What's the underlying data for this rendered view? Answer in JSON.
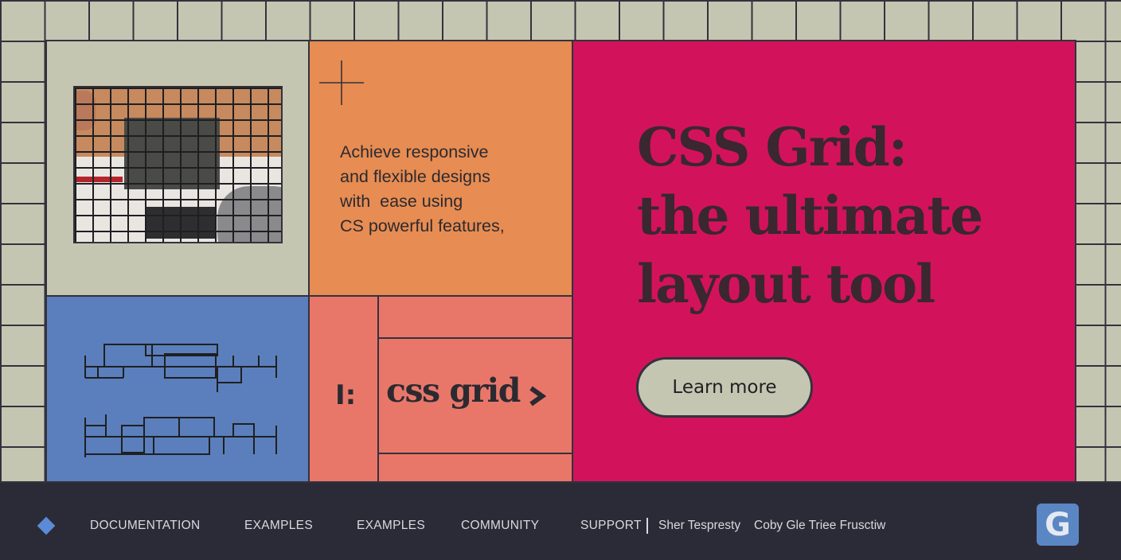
{
  "hero": {
    "description": "Achieve responsive\nand flexible designs\nwith  ease using\nCS powerful features,",
    "headline": "CSS Grid:\nthe ultimate\nlayout tool",
    "cta_label": "Learn more"
  },
  "badge": {
    "icon_text": "I:",
    "label": "css grid"
  },
  "footer": {
    "nav": [
      {
        "label": "DOCUMENTATION"
      },
      {
        "label": "EXAMPLES"
      },
      {
        "label": "EXAMPLES"
      },
      {
        "label": "COMMUNITY"
      },
      {
        "label": "SUPPORT"
      },
      {
        "label": "Sher Tespresty"
      },
      {
        "label": "Coby Gle Triee Frusctiw"
      }
    ],
    "logo_letter": "G"
  },
  "colors": {
    "background": "#c5c6b2",
    "orange": "#e78c52",
    "pink": "#d2135c",
    "blue": "#5b7fbc",
    "salmon": "#e8776a",
    "footer": "#2b2b37",
    "accent": "#5b8bd6"
  },
  "icons": [
    "crosshair-icon",
    "chevron-right-icon",
    "diamond-icon",
    "g-logo-icon"
  ]
}
